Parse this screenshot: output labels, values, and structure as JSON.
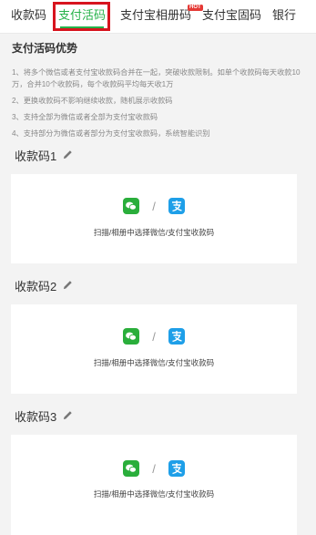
{
  "tabs": [
    {
      "label": "收款码",
      "active": false
    },
    {
      "label": "支付活码",
      "active": true
    },
    {
      "label": "支付宝相册码",
      "active": false,
      "badge": "HOT"
    },
    {
      "label": "支付宝固码",
      "active": false
    },
    {
      "label": "银行",
      "active": false
    }
  ],
  "intro": {
    "title": "支付活码优势",
    "items": [
      "1、将多个微信或者支付宝收款码合并在一起，突破收款限制。如单个收款码每天收款10万，合并10个收款码，每个收款码平均每天收1万",
      "2、更换收款码不影响继续收款，随机展示收款码",
      "3、支持全部为微信或者全部为支付宝收款码",
      "4、支持部分为微信或者部分为支付宝收款码，系统智能识别"
    ]
  },
  "sections": [
    {
      "title": "收款码1",
      "separator": "/",
      "instruction": "扫描/相册中选择微信/支付宝收款码"
    },
    {
      "title": "收款码2",
      "separator": "/",
      "instruction": "扫描/相册中选择微信/支付宝收款码"
    },
    {
      "title": "收款码3",
      "separator": "/",
      "instruction": "扫描/相册中选择微信/支付宝收款码"
    }
  ],
  "colors": {
    "accent": "#27b24a",
    "highlight": "#d7141e",
    "wechat": "#2aae3b",
    "alipay": "#1e9fe8"
  },
  "icons": {
    "edit": "pencil-icon",
    "wechat": "wechat-icon",
    "alipay": "alipay-icon"
  }
}
